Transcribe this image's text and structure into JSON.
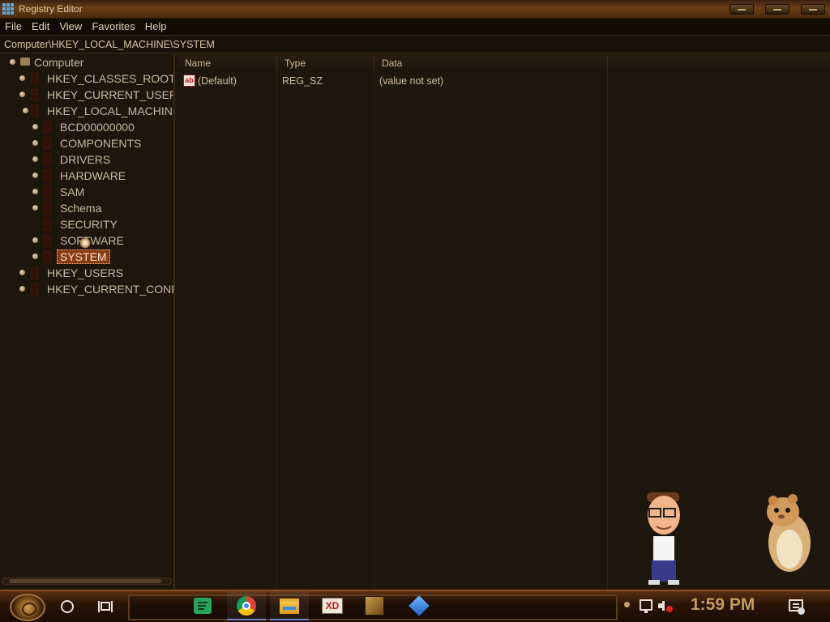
{
  "window": {
    "title": "Registry Editor"
  },
  "menu": [
    "File",
    "Edit",
    "View",
    "Favorites",
    "Help"
  ],
  "address": {
    "path": "Computer\\HKEY_LOCAL_MACHINE\\SYSTEM"
  },
  "tree": {
    "root": "Computer",
    "hives": [
      "HKEY_CLASSES_ROOT",
      "HKEY_CURRENT_USER",
      "HKEY_LOCAL_MACHINE",
      "HKEY_USERS",
      "HKEY_CURRENT_CONFIG"
    ],
    "hklm_children": [
      "BCD00000000",
      "COMPONENTS",
      "DRIVERS",
      "HARDWARE",
      "SAM",
      "Schema",
      "SECURITY",
      "SOFTWARE",
      "SYSTEM"
    ],
    "selected": "SYSTEM"
  },
  "list": {
    "columns": [
      "Name",
      "Type",
      "Data"
    ],
    "rows": [
      {
        "name": "(Default)",
        "type": "REG_SZ",
        "data": "(value not set)",
        "icon": "string-value-icon"
      }
    ]
  },
  "taskbar": {
    "apps": [
      "spotify-icon",
      "chrome-icon",
      "file-explorer-icon",
      "xd-icon",
      "game-icon",
      "cube-app-icon"
    ],
    "clock": "1:59 PM"
  },
  "colors": {
    "accent": "#8a3b16",
    "title_gradient": "#6b3e14",
    "text": "#c8b9a4",
    "clock": "#c79a5a"
  }
}
